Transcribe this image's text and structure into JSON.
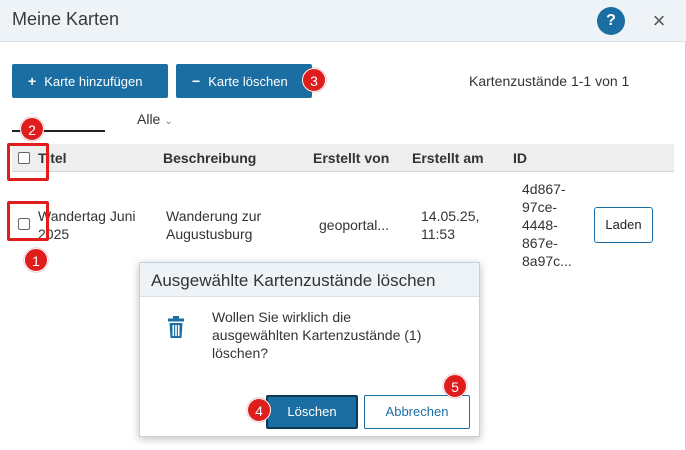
{
  "window": {
    "title": "Meine Karten",
    "help_label": "?",
    "close_label": "×"
  },
  "toolbar": {
    "add_label": "Karte hinzufügen",
    "add_glyph": "+",
    "delete_label": "Karte löschen",
    "delete_glyph": "−",
    "count_text": "Kartenzustände 1-1 von 1"
  },
  "filter": {
    "selected": "Alle",
    "chevron": "⌄"
  },
  "table": {
    "columns": [
      "Titel",
      "Beschreibung",
      "Erstellt von",
      "Erstellt am",
      "ID"
    ],
    "rows": [
      {
        "title_line1": "Wandertag Juni",
        "title_line2": "2025",
        "description_line1": "Wanderung zur",
        "description_line2": "Augustusburg",
        "created_by": "geoportal...",
        "created_date": "14.05.25,",
        "created_time": "11:53",
        "id_lines": [
          "4d867-",
          "97ce-",
          "4448-",
          "867e-",
          "8a97c..."
        ],
        "action_label": "Laden"
      }
    ]
  },
  "confirm_dialog": {
    "title": "Ausgewählte Kartenzustände löschen",
    "message_lines": [
      "Wollen Sie wirklich die",
      "ausgewählten Kartenzustände (1)",
      "löschen?"
    ],
    "confirm_label": "Löschen",
    "cancel_label": "Abbrechen",
    "icon": "trash-icon"
  },
  "annotations": {
    "badge_1": "1",
    "badge_2": "2",
    "badge_3": "3",
    "badge_4": "4",
    "badge_5": "5"
  },
  "colors": {
    "primary": "#1b6ea1",
    "annotation": "#e01d1d",
    "header_bg": "#eef3f7"
  }
}
